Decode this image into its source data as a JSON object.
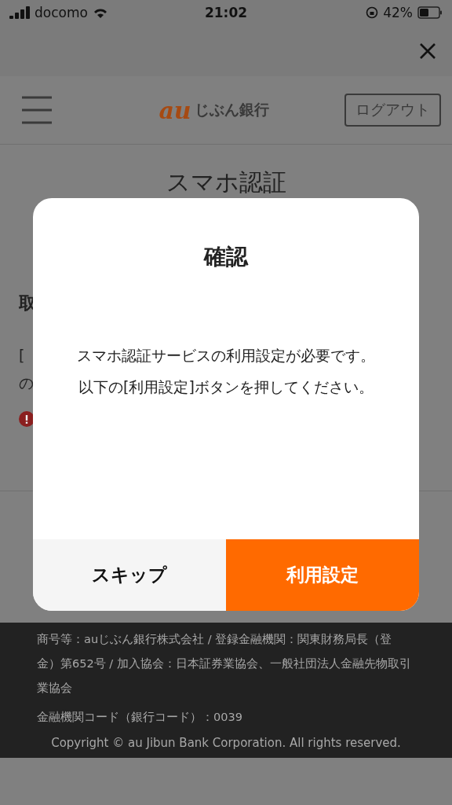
{
  "status_bar": {
    "carrier": "docomo",
    "time": "21:02",
    "battery": "42%"
  },
  "header": {
    "logo_mark": "au",
    "logo_text": "じぶん銀行",
    "logout": "ログアウト"
  },
  "page": {
    "title": "スマホ認証",
    "section_heading": "取",
    "text_fragments": [
      "[",
      "の"
    ]
  },
  "dialog": {
    "title": "確認",
    "message": [
      "スマホ認証サービスの利用設定が必要です。",
      "以下の[利用設定]ボタンを押してください。"
    ],
    "buttons": [
      {
        "label": "スキップ",
        "kind": "secondary"
      },
      {
        "label": "利用設定",
        "kind": "primary"
      }
    ]
  },
  "footer": {
    "company": "商号等：auじぶん銀行株式会社 / 登録金融機関：関東財務局長（登金）第652号 / 加入協会：日本証券業協会、一般社団法人金融先物取引業協会",
    "bank_code": "金融機関コード（銀行コード）：0039",
    "copyright": "Copyright © au Jibun Bank Corporation. All rights reserved."
  }
}
